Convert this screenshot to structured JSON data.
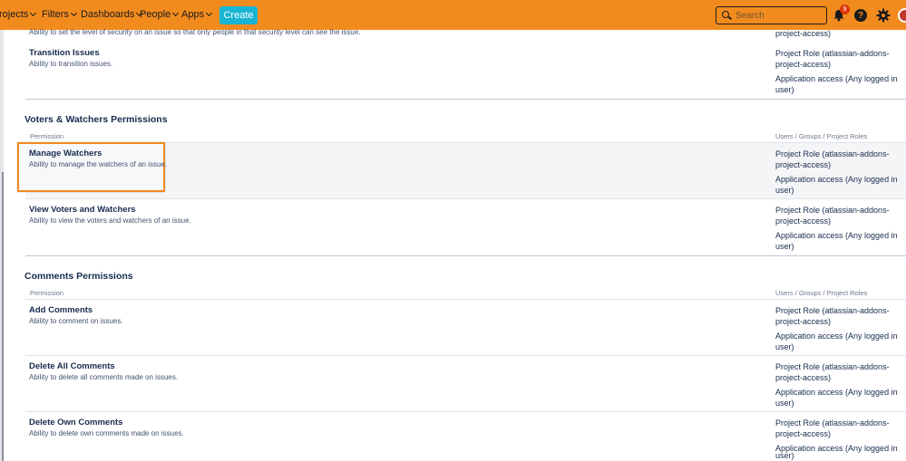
{
  "nav": {
    "items": [
      "rojects",
      "Filters",
      "Dashboards",
      "People",
      "Apps"
    ],
    "create_label": "Create",
    "search_placeholder": "Search",
    "notification_count": "9",
    "help_glyph": "?"
  },
  "top_partial": {
    "description": "Ability to set the level of security on an issue so that only people in that security level can see the issue.",
    "role": "project-access)"
  },
  "transition": {
    "title": "Transition Issues",
    "description": "Ability to transition issues.",
    "role1a": "Project Role (atlassian-addons-",
    "role1b": "project-access)",
    "role2a": "Application access (Any logged in",
    "role2b": "user)"
  },
  "voters_section": {
    "heading": "Voters & Watchers Permissions",
    "col_permission": "Permission",
    "col_roles": "Users / Groups / Project Roles",
    "rows": [
      {
        "title": "Manage Watchers",
        "description": "Ability to manage the watchers of an issue.",
        "role1a": "Project Role (atlassian-addons-",
        "role1b": "project-access)",
        "role2a": "Application access (Any logged in",
        "role2b": "user)"
      },
      {
        "title": "View Voters and Watchers",
        "description": "Ability to view the voters and watchers of an issue.",
        "role1a": "Project Role (atlassian-addons-",
        "role1b": "project-access)",
        "role2a": "Application access (Any logged in",
        "role2b": "user)"
      }
    ]
  },
  "comments_section": {
    "heading": "Comments Permissions",
    "col_permission": "Permission",
    "col_roles": "Users / Groups / Project Roles",
    "rows": [
      {
        "title": "Add Comments",
        "description": "Ability to comment on issues.",
        "role1a": "Project Role (atlassian-addons-",
        "role1b": "project-access)",
        "role2a": "Application access (Any logged in",
        "role2b": "user)"
      },
      {
        "title": "Delete All Comments",
        "description": "Ability to delete all comments made on issues.",
        "role1a": "Project Role (atlassian-addons-",
        "role1b": "project-access)",
        "role2a": "Application access (Any logged in",
        "role2b": "user)"
      },
      {
        "title": "Delete Own Comments",
        "description": "Ability to delete own comments made on issues.",
        "role1a": "Project Role (atlassian-addons-",
        "role1b": "project-access)",
        "role2a": "Application access (Any logged in",
        "role2b": "user)"
      }
    ]
  },
  "colors": {
    "topbar": "#f28b1e",
    "create_button": "#19b4d4",
    "highlight_border": "#f28b1e",
    "badge": "#de350b"
  }
}
